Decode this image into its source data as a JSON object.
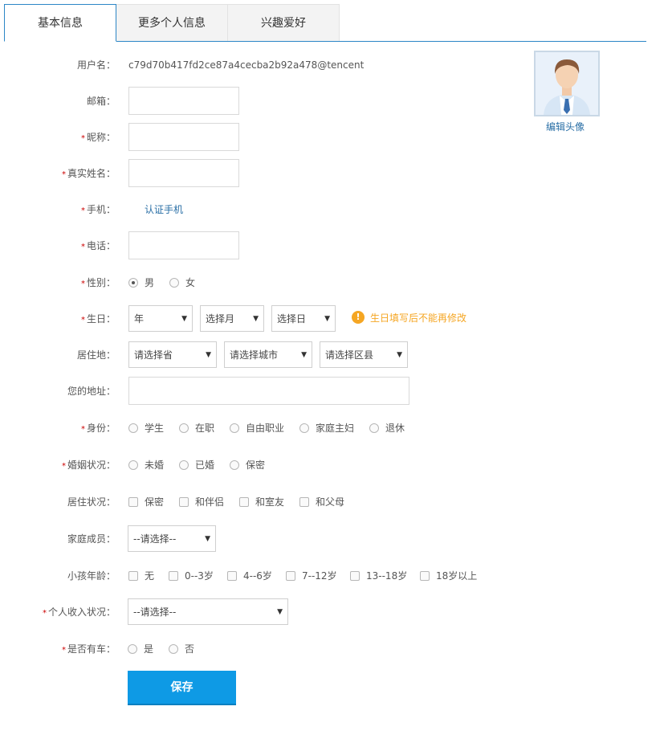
{
  "tabs": [
    "基本信息",
    "更多个人信息",
    "兴趣爱好"
  ],
  "avatar": {
    "edit_label": "编辑头像"
  },
  "fields": {
    "username": {
      "label": "用户名：",
      "value": "c79d70b417fd2ce87a4cecba2b92a478@tencent"
    },
    "email": {
      "label": "邮箱："
    },
    "nickname": {
      "label": "昵称："
    },
    "realname": {
      "label": "真实姓名："
    },
    "phone_mobile": {
      "label": "手机：",
      "link": "认证手机"
    },
    "telephone": {
      "label": "电话："
    },
    "gender": {
      "label": "性别：",
      "options": [
        "男",
        "女"
      ],
      "selected": "男"
    },
    "birthday": {
      "label": "生日：",
      "year": "年",
      "month": "选择月",
      "day": "选择日",
      "warning": "生日填写后不能再修改"
    },
    "residence": {
      "label": "居住地：",
      "province": "请选择省",
      "city": "请选择城市",
      "district": "请选择区县"
    },
    "address": {
      "label": "您的地址："
    },
    "identity": {
      "label": "身份：",
      "options": [
        "学生",
        "在职",
        "自由职业",
        "家庭主妇",
        "退休"
      ]
    },
    "marital": {
      "label": "婚姻状况：",
      "options": [
        "未婚",
        "已婚",
        "保密"
      ]
    },
    "living": {
      "label": "居住状况：",
      "options": [
        "保密",
        "和伴侣",
        "和室友",
        "和父母"
      ]
    },
    "family": {
      "label": "家庭成员：",
      "selected": "--请选择--"
    },
    "child_age": {
      "label": "小孩年龄：",
      "options": [
        "无",
        "0--3岁",
        "4--6岁",
        "7--12岁",
        "13--18岁",
        "18岁以上"
      ]
    },
    "income": {
      "label": "个人收入状况：",
      "selected": "--请选择--"
    },
    "car": {
      "label": "是否有车：",
      "options": [
        "是",
        "否"
      ]
    }
  },
  "required_mark": "*",
  "arrow_glyph": "▼",
  "warn_glyph": "!",
  "save_label": "保存"
}
